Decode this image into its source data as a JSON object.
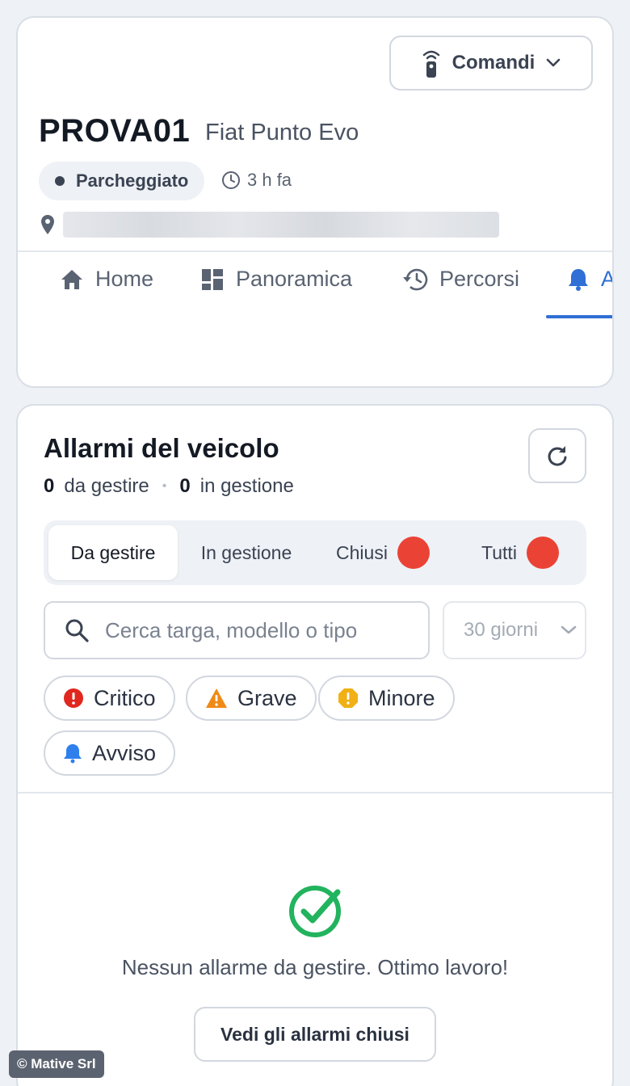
{
  "vehicle": {
    "commands_label": "Comandi",
    "plate": "PROVA01",
    "model": "Fiat Punto Evo",
    "status": "Parcheggiato",
    "time_ago": "3 h fa"
  },
  "nav": {
    "tabs": [
      {
        "label": "Home",
        "icon": "home-icon"
      },
      {
        "label": "Panoramica",
        "icon": "dashboard-icon"
      },
      {
        "label": "Percorsi",
        "icon": "history-icon"
      },
      {
        "label": "A",
        "icon": "bell-icon",
        "active": true
      }
    ]
  },
  "alarms": {
    "title": "Allarmi del veicolo",
    "to_handle_count": "0",
    "to_handle_label": "da gestire",
    "in_progress_count": "0",
    "in_progress_label": "in gestione",
    "tabs": [
      {
        "label": "Da gestire",
        "active": true
      },
      {
        "label": "In gestione"
      },
      {
        "label": "Chiusi"
      },
      {
        "label": "Tutti"
      }
    ],
    "search_placeholder": "Cerca targa, modello o tipo",
    "period": "30 giorni",
    "chips": [
      {
        "label": "Critico",
        "icon": "critical-icon",
        "color": "#e0281f"
      },
      {
        "label": "Grave",
        "icon": "warning-icon",
        "color": "#f08a16"
      },
      {
        "label": "Minore",
        "icon": "minor-icon",
        "color": "#f0b016"
      },
      {
        "label": "Avviso",
        "icon": "bell-icon",
        "color": "#2f80ed"
      }
    ],
    "empty_message": "Nessun allarme da gestire. Ottimo lavoro!",
    "closed_button": "Vedi gli allarmi chiusi"
  },
  "copyright": "© Mative Srl",
  "colors": {
    "accent": "#2f6fd6",
    "badge": "#ea4335",
    "success": "#22b35e"
  }
}
